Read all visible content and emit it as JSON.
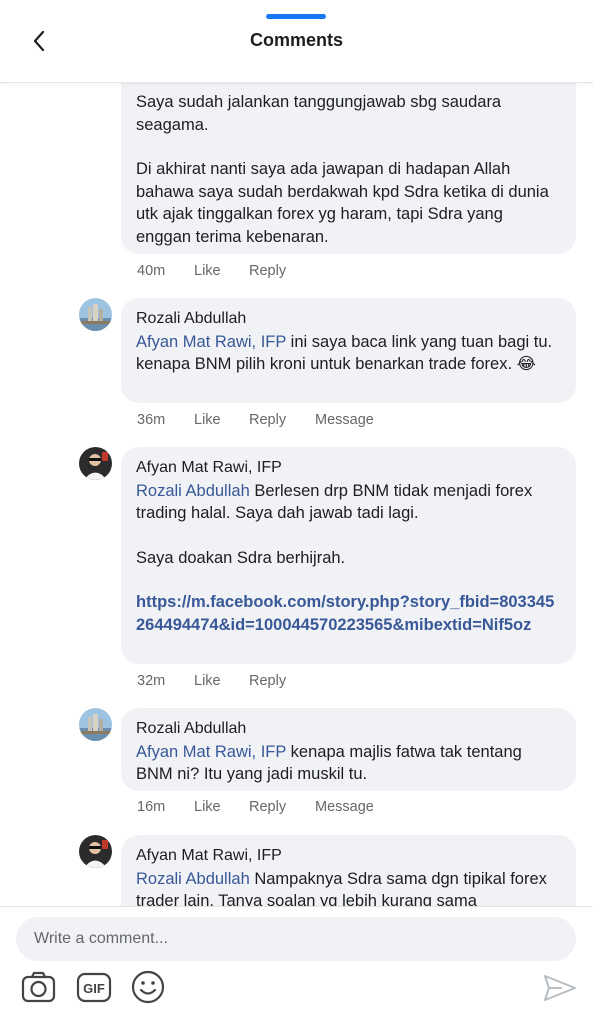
{
  "header": {
    "title": "Comments"
  },
  "comments": [
    {
      "text1": "Saya sudah jalankan tanggungjawab sbg saudara seagama.",
      "text2": "Di akhirat nanti saya ada jawapan di hadapan Allah bahawa saya sudah berdakwah kpd Sdra ketika di dunia utk ajak tinggalkan forex yg haram, tapi Sdra yang enggan terima kebenaran.",
      "time": "40m",
      "like": "Like",
      "reply": "Reply"
    },
    {
      "author": "Rozali Abdullah",
      "mention": "Afyan Mat Rawi, IFP",
      "text": " ini saya baca link yang tuan bagi tu. kenapa BNM pilih kroni untuk benarkan trade forex. 😂",
      "time": "36m",
      "like": "Like",
      "reply": "Reply",
      "message": "Message"
    },
    {
      "author": "Afyan Mat Rawi, IFP",
      "mention": "Rozali Abdullah",
      "text": " Berlesen drp BNM tidak menjadi forex trading halal. Saya dah jawab tadi lagi.",
      "text2": "Saya doakan Sdra berhijrah.",
      "link": "https://m.facebook.com/story.php?story_fbid=803345264494474&id=100044570223565&mibextid=Nif5oz",
      "time": "32m",
      "like": "Like",
      "reply": "Reply"
    },
    {
      "author": "Rozali Abdullah",
      "mention": "Afyan Mat Rawi, IFP",
      "text": " kenapa majlis fatwa tak tentang BNM ni? Itu yang jadi muskil tu.",
      "time": "16m",
      "like": "Like",
      "reply": "Reply",
      "message": "Message"
    },
    {
      "author": "Afyan Mat Rawi, IFP",
      "mention": "Rozali Abdullah",
      "text": " Nampaknya Sdra sama dgn tipikal forex trader lain. Tanya soalan yg lebih kurang sama"
    }
  ],
  "composer": {
    "placeholder": "Write a comment...",
    "icons": [
      "camera-icon",
      "gif-icon",
      "emoji-icon",
      "send-icon"
    ]
  },
  "colors": {
    "accent": "#1877f2",
    "mention": "#385898",
    "bubble": "#f0f2f5",
    "meta": "#65676b"
  }
}
